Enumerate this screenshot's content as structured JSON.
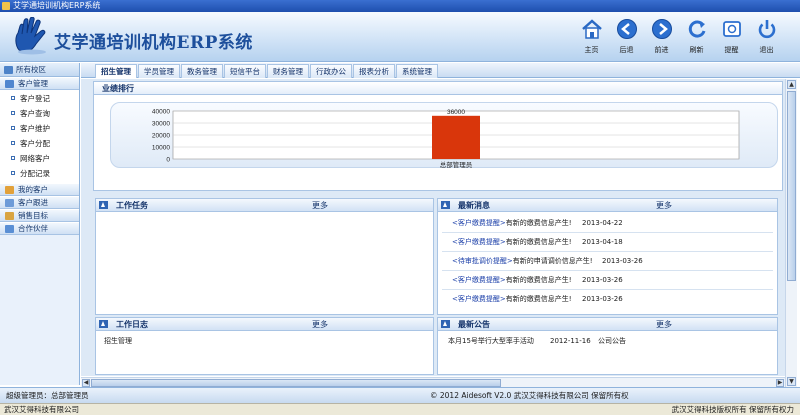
{
  "window": {
    "title": "艾学通培训机构ERP系统"
  },
  "header": {
    "logo_title": "艾学通培训机构ERP系统",
    "tools": [
      {
        "label": "主页",
        "icon": "home-icon"
      },
      {
        "label": "后退",
        "icon": "back-icon"
      },
      {
        "label": "前进",
        "icon": "forward-icon"
      },
      {
        "label": "刷新",
        "icon": "refresh-icon"
      },
      {
        "label": "提醒",
        "icon": "reminder-icon"
      },
      {
        "label": "退出",
        "icon": "power-icon"
      }
    ]
  },
  "sidebar": {
    "top_label": "所有校区",
    "groups": [
      {
        "label": "客户管理",
        "items": [
          "客户登记",
          "客户查询",
          "客户维护",
          "客户分配",
          "网络客户",
          "分配记录"
        ]
      },
      {
        "label": "我的客户",
        "items": []
      },
      {
        "label": "客户跟进",
        "items": []
      },
      {
        "label": "销售目标",
        "items": []
      },
      {
        "label": "合作伙伴",
        "items": []
      }
    ]
  },
  "tabs": [
    "招生管理",
    "学员管理",
    "教务管理",
    "短信平台",
    "财务管理",
    "行政办公",
    "报表分析",
    "系统管理"
  ],
  "performance": {
    "title": "业绩排行",
    "chart_data": {
      "type": "bar",
      "categories": [
        "总部管理员"
      ],
      "values": [
        36000
      ],
      "data_labels": [
        "36000"
      ],
      "ylim": [
        0,
        40000
      ],
      "yticks": [
        0,
        10000,
        20000,
        30000,
        40000
      ],
      "bar_color": "#d9360b",
      "grid": true
    }
  },
  "tasks": {
    "title": "工作任务",
    "more": "更多"
  },
  "news": {
    "title": "最新消息",
    "more": "更多",
    "rows": [
      {
        "link": "<客户缴费提醒>",
        "text": "有新的缴费信息产生!",
        "date": "2013-04-22"
      },
      {
        "link": "<客户缴费提醒>",
        "text": "有新的缴费信息产生!",
        "date": "2013-04-18"
      },
      {
        "link": "<待审批调价提醒>",
        "text": "有新的申请调价信息产生!",
        "date": "2013-03-26"
      },
      {
        "link": "<客户缴费提醒>",
        "text": "有新的缴费信息产生!",
        "date": "2013-03-26"
      },
      {
        "link": "<客户缴费提醒>",
        "text": "有新的缴费信息产生!",
        "date": "2013-03-26"
      }
    ]
  },
  "worklog": {
    "title": "工作日志",
    "more": "更多",
    "entry": "招生管理"
  },
  "notices": {
    "title": "最新公告",
    "more": "更多",
    "rows": [
      {
        "text": "本月15号举行大型率手活动",
        "date": "2012-11-16",
        "author": "公司公告"
      }
    ]
  },
  "status": {
    "user": "超级管理员：总部管理员",
    "copyright": "© 2012 Aidesoft V2.0 武汉艾得科技有限公司 保留所有权"
  },
  "bottom": {
    "left": "武汉艾得科技有限公司",
    "right": "武汉艾得科技版权所有 保留所有权力"
  }
}
